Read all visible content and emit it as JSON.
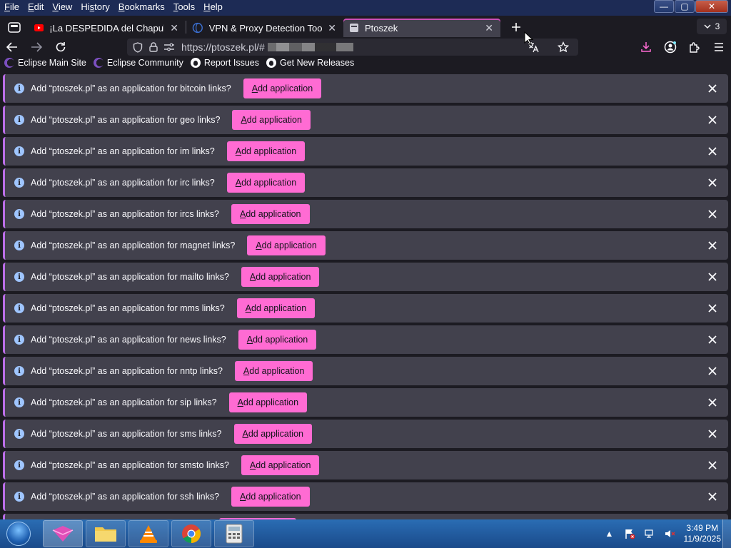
{
  "menu": {
    "items": [
      "File",
      "Edit",
      "View",
      "History",
      "Bookmarks",
      "Tools",
      "Help"
    ],
    "underlines": [
      "F",
      "E",
      "V",
      "s",
      "B",
      "T",
      "H"
    ]
  },
  "window_controls": {
    "minimize": "—",
    "maximize": "▢",
    "close": "✕"
  },
  "tabs": [
    {
      "title": "¡La DESPEDIDA del Chapulín Co",
      "favicon": "youtube-icon",
      "active": false
    },
    {
      "title": "VPN & Proxy Detection Tool",
      "favicon": "globe-icon",
      "active": false
    },
    {
      "title": "Ptoszek",
      "favicon": "page-icon",
      "active": true
    }
  ],
  "tab_overflow_count": "3",
  "urlbar": {
    "url_prefix": "https://ptoszek.pl/#"
  },
  "bookmarks": [
    {
      "label": "Eclipse Main Site",
      "icon": "eclipse-icon"
    },
    {
      "label": "Eclipse Community",
      "icon": "eclipse-icon"
    },
    {
      "label": "Report Issues",
      "icon": "github-icon"
    },
    {
      "label": "Get New Releases",
      "icon": "github-icon"
    }
  ],
  "notifications": {
    "button_label_first": "A",
    "button_label_rest": "dd application",
    "items": [
      {
        "message": "Add “ptoszek.pl” as an application for bitcoin links?"
      },
      {
        "message": "Add “ptoszek.pl” as an application for geo links?"
      },
      {
        "message": "Add “ptoszek.pl” as an application for im links?"
      },
      {
        "message": "Add “ptoszek.pl” as an application for irc links?"
      },
      {
        "message": "Add “ptoszek.pl” as an application for ircs links?"
      },
      {
        "message": "Add “ptoszek.pl” as an application for magnet links?"
      },
      {
        "message": "Add “ptoszek.pl” as an application for mailto links?"
      },
      {
        "message": "Add “ptoszek.pl” as an application for mms links?"
      },
      {
        "message": "Add “ptoszek.pl” as an application for news links?"
      },
      {
        "message": "Add “ptoszek.pl” as an application for nntp links?"
      },
      {
        "message": "Add “ptoszek.pl” as an application for sip links?"
      },
      {
        "message": "Add “ptoszek.pl” as an application for sms links?"
      },
      {
        "message": "Add “ptoszek.pl” as an application for smsto links?"
      },
      {
        "message": "Add “ptoszek.pl” as an application for ssh links?"
      }
    ]
  },
  "taskbar": {
    "apps": [
      "app-icon",
      "folder-icon",
      "vlc-icon",
      "chrome-icon",
      "calculator-icon"
    ],
    "clock_time": "3:49 PM",
    "clock_date": "11/9/2025"
  },
  "colors": {
    "accent_pink": "#ff6bd3",
    "notif_bg": "#42414d",
    "page_bg": "#1c1b22",
    "taskbar": "#2a6db4"
  }
}
